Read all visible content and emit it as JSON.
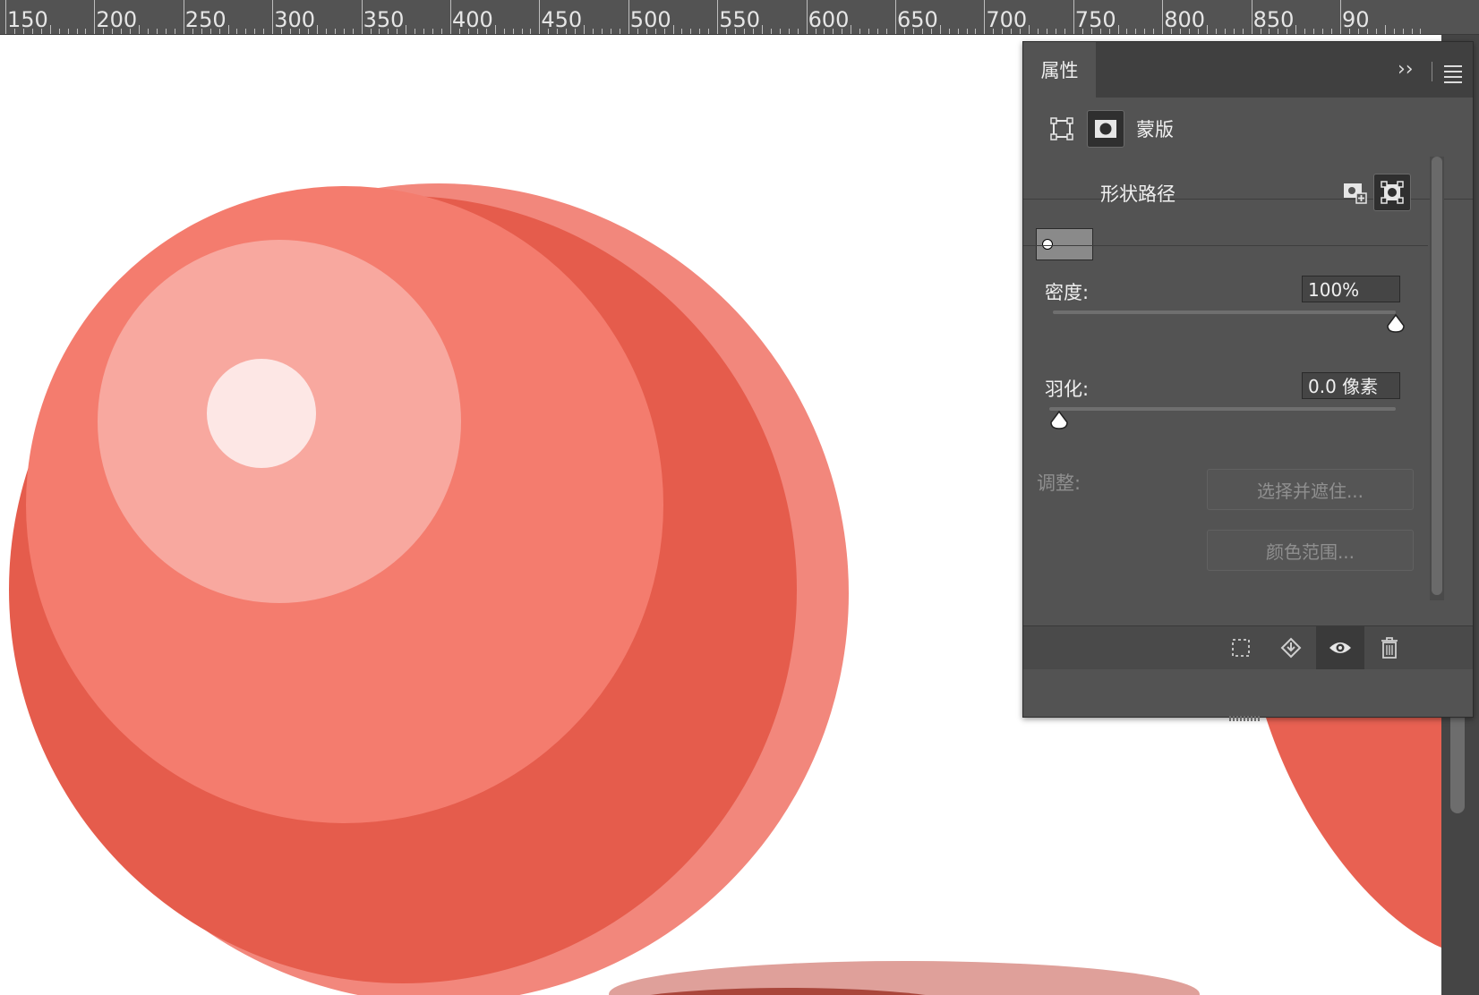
{
  "ruler": {
    "units": "px",
    "labels": [
      "150",
      "200",
      "250",
      "300",
      "350",
      "400",
      "450",
      "500",
      "550",
      "600",
      "650",
      "700",
      "750",
      "800",
      "850",
      "90"
    ]
  },
  "panel": {
    "title": "属性",
    "collapse_icon": "double-chevron-right",
    "menu_icon": "hamburger-menu",
    "type_row": {
      "pixel_mask_icon": "pixel-mask-square",
      "vector_mask_icon": "vector-mask-circle",
      "label": "蒙版"
    },
    "shape_path": {
      "label": "形状路径",
      "add_mask_icon": "add-vector-mask",
      "selected_icon": "vector-mask-selected"
    },
    "density": {
      "label": "密度:",
      "value": "100%",
      "level": 1.0
    },
    "feather": {
      "label": "羽化:",
      "value": "0.0 像素",
      "level": 0.0
    },
    "adjust": {
      "label": "调整:",
      "select_mask_button": "选择并遮住...",
      "color_range_button": "颜色范围..."
    },
    "bottom_bar": [
      "selection-from-mask",
      "apply-mask",
      "visibility-eye",
      "trash"
    ]
  },
  "colors": {
    "ruler_bg": "#535353",
    "panel_bg": "#535353",
    "sphere_dark": "#E55C4C",
    "sphere_mid": "#F47C6E",
    "sphere_rim": "#F2877C",
    "highlight": "#F8A89F",
    "specular": "#FDE7E5",
    "shadow": "#DFA09A"
  }
}
